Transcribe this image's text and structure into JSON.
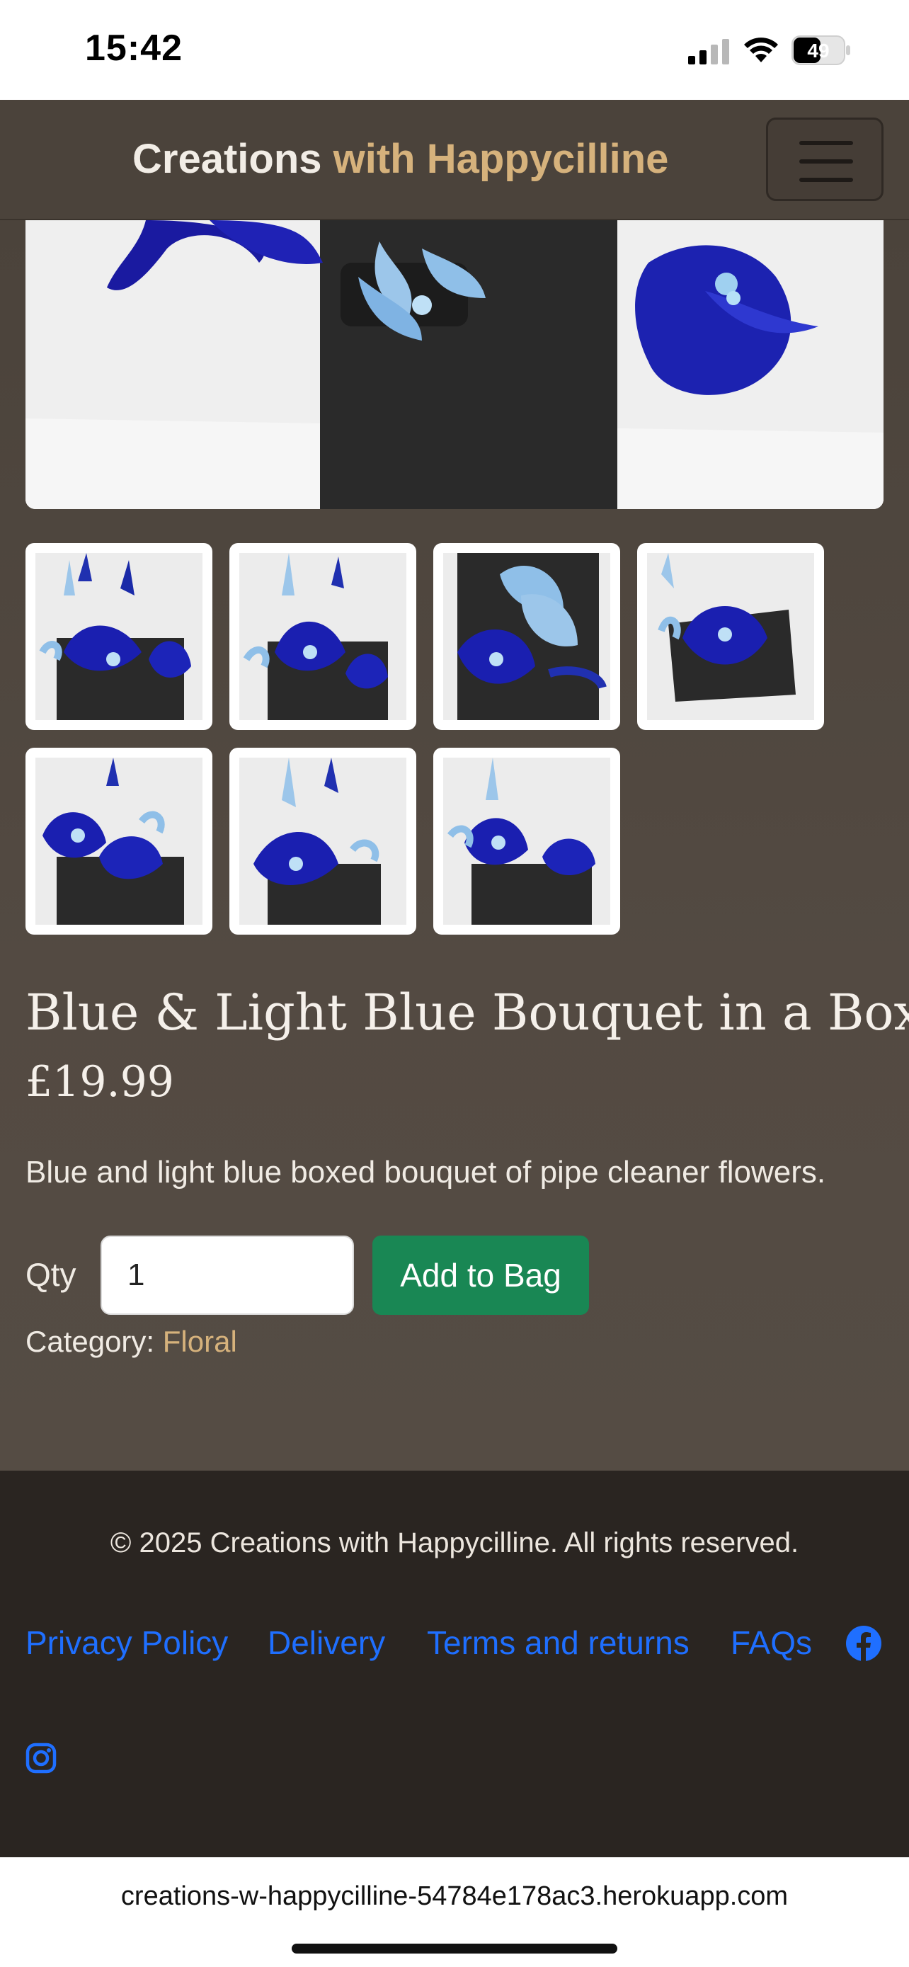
{
  "status_bar": {
    "time": "15:42",
    "battery": "49"
  },
  "navbar": {
    "brand_main": "Creations",
    "brand_accent": "with Happycilline"
  },
  "product": {
    "title": "Blue & Light Blue Bouquet in a Box",
    "price": "£19.99",
    "description": "Blue and light blue boxed bouquet of pipe cleaner flowers.",
    "qty_label": "Qty",
    "qty_value": "1",
    "add_button": "Add to Bag",
    "category_label": "Category:",
    "category_value": "Floral"
  },
  "colors": {
    "accent": "#d6b27c",
    "button": "#198754",
    "link": "#1f6fff",
    "navbar": "#4b433b",
    "footer": "#2a2521"
  },
  "footer": {
    "copyright": "© 2025 Creations with Happycilline. All rights reserved.",
    "links": [
      "Privacy Policy",
      "Delivery",
      "Terms and returns",
      "FAQs"
    ],
    "icons": [
      "facebook-icon",
      "instagram-icon"
    ]
  },
  "browser": {
    "url": "creations-w-happycilline-54784e178ac3.herokuapp.com"
  }
}
